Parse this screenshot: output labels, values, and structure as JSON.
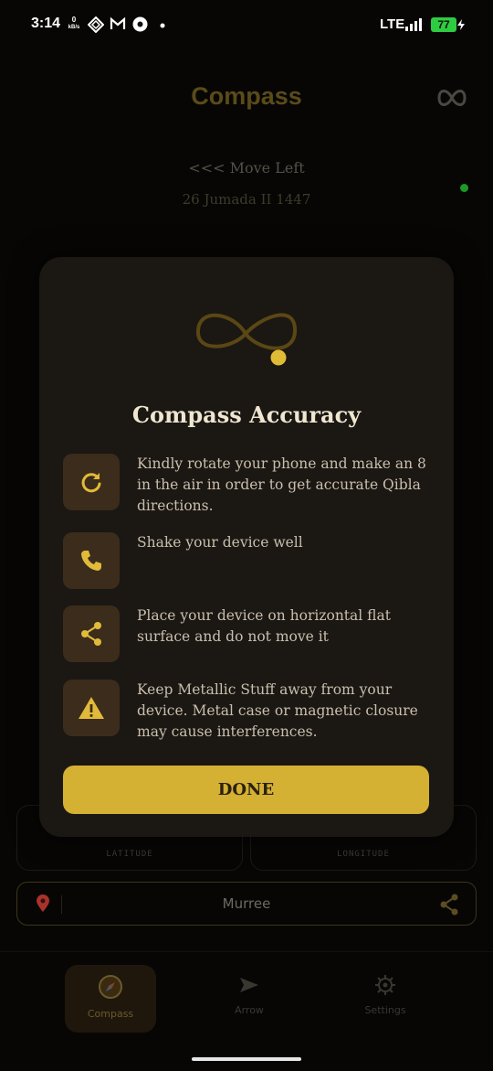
{
  "status_bar": {
    "time": "3:14",
    "data_speed_value": "0",
    "data_speed_unit": "kB/s",
    "network": "LTE",
    "battery": "77"
  },
  "app": {
    "title": "Compass",
    "move_hint": "<<< Move Left",
    "hijri_date": "26 Jumada II 1447",
    "latitude_label": "LATITUDE",
    "longitude_label": "LONGITUDE",
    "location": "Murree"
  },
  "nav": {
    "items": [
      {
        "label": "Compass",
        "icon": "compass-icon",
        "active": true
      },
      {
        "label": "Arrow",
        "icon": "arrow-icon",
        "active": false
      },
      {
        "label": "Settings",
        "icon": "gear-icon",
        "active": false
      }
    ]
  },
  "dialog": {
    "title": "Compass Accuracy",
    "tips": [
      {
        "icon": "refresh-icon",
        "text": "Kindly rotate your phone and make an 8 in the air in order to get accurate Qibla directions."
      },
      {
        "icon": "phone-icon",
        "text": "Shake your device well"
      },
      {
        "icon": "share-icon",
        "text": "Place your device on horizontal flat surface and do not move it"
      },
      {
        "icon": "warning-icon",
        "text": "Keep Metallic Stuff away from your device. Metal case or magnetic closure may cause interferences."
      }
    ],
    "done_label": "DONE"
  },
  "colors": {
    "accent": "#d4b033",
    "dialog_bg": "#1b1713",
    "icon_tile": "#3b2c1c"
  }
}
